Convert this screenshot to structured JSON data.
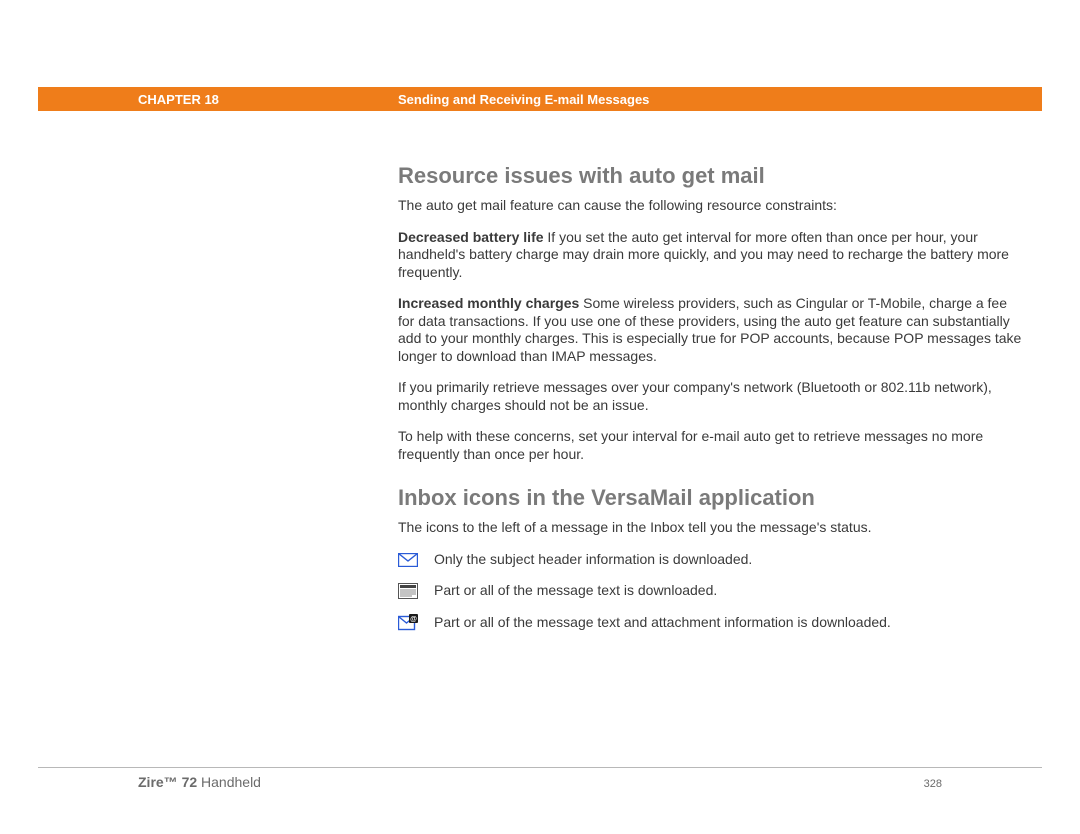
{
  "header": {
    "chapter": "CHAPTER 18",
    "section": "Sending and Receiving E-mail Messages"
  },
  "sections": [
    {
      "heading": "Resource issues with auto get mail",
      "intro": "The auto get mail feature can cause the following resource constraints:",
      "paras": [
        {
          "runin": "Decreased battery life",
          "text": "   If you set the auto get interval for more often than once per hour, your handheld's battery charge may drain more quickly, and you may need to recharge the battery more frequently."
        },
        {
          "runin": "Increased monthly charges",
          "text": "   Some wireless providers, such as Cingular or T-Mobile, charge a fee for data transactions. If you use one of these providers, using the auto get feature can substantially add to your monthly charges. This is especially true for POP accounts, because POP messages take longer to download than IMAP messages."
        },
        {
          "runin": "",
          "text": "If you primarily retrieve messages over your company's network (Bluetooth or 802.11b network), monthly charges should not be an issue."
        },
        {
          "runin": "",
          "text": "To help with these concerns, set your interval for e-mail auto get to retrieve messages no more frequently than once per hour."
        }
      ]
    },
    {
      "heading": "Inbox icons in the VersaMail application",
      "intro": "The icons to the left of a message in the Inbox tell you the message's status.",
      "icons": [
        {
          "label": "Only the subject header information is downloaded."
        },
        {
          "label": "Part or all of the message text is downloaded."
        },
        {
          "label": "Part or all of the message text and attachment information is downloaded."
        }
      ]
    }
  ],
  "footer": {
    "product_bold": "Zire™ 72",
    "product_rest": " Handheld",
    "page": "328"
  }
}
